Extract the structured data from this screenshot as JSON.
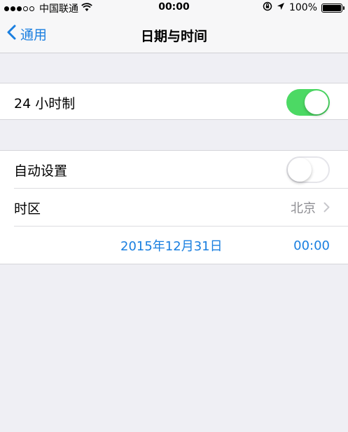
{
  "status_bar": {
    "signal_dots_filled": 3,
    "signal_dots_total": 5,
    "carrier": "中国联通",
    "wifi_icon": "wifi-icon",
    "time": "00:00",
    "lock_icon": "orientation-lock-icon",
    "location_icon": "location-arrow-icon",
    "battery_percent": "100%"
  },
  "nav": {
    "back_label": "通用",
    "title": "日期与时间"
  },
  "settings": {
    "hour24": {
      "label": "24 小时制",
      "enabled": true
    },
    "auto_set": {
      "label": "自动设置",
      "enabled": false
    },
    "timezone": {
      "label": "时区",
      "value": "北京"
    },
    "date": "2015年12月31日",
    "time": "00:00"
  },
  "colors": {
    "accent": "#1a7fe0",
    "toggle_on": "#4cd964",
    "background": "#efeff4"
  }
}
